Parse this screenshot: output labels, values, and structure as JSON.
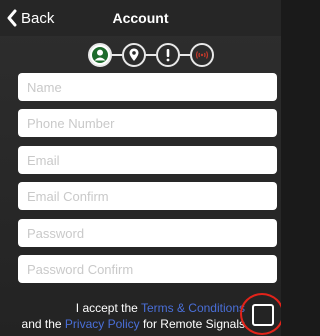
{
  "navbar": {
    "back_label": "Back",
    "title": "Account"
  },
  "steps": [
    {
      "icon": "person-icon",
      "active": true
    },
    {
      "icon": "location-pin-icon",
      "active": false
    },
    {
      "icon": "exclamation-icon",
      "active": false
    },
    {
      "icon": "signal-icon",
      "active": false
    }
  ],
  "form": {
    "name_placeholder": "Name",
    "phone_placeholder": "Phone Number",
    "email_placeholder": "Email",
    "email_confirm_placeholder": "Email Confirm",
    "password_placeholder": "Password",
    "password_confirm_placeholder": "Password Confirm"
  },
  "terms": {
    "line1_prefix": "I accept the",
    "terms_link": "Terms & Conditions",
    "line2_prefix": "and the",
    "privacy_link": "Privacy Policy",
    "line2_suffix": "for Remote Signals"
  },
  "colors": {
    "link": "#4a6fd8",
    "highlight": "#e2231a",
    "background": "#2a2a2a"
  }
}
